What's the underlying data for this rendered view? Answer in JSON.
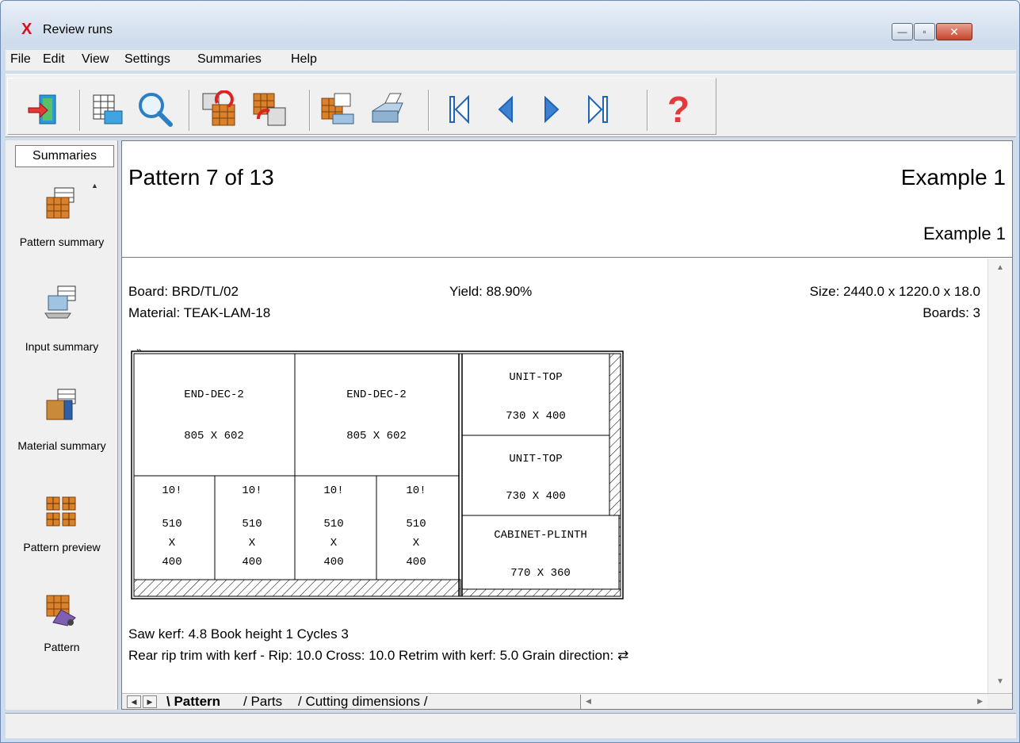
{
  "window": {
    "title": "Review runs",
    "logo": "X",
    "controls": {
      "minimize": "—",
      "maximize": "▫",
      "close": "✕"
    }
  },
  "menu": [
    "File",
    "Edit",
    "View",
    "Settings",
    "Summaries",
    "Help"
  ],
  "toolbar": {
    "icons": [
      "exit-icon",
      "input-table-icon",
      "search-icon",
      "undo-pattern-icon",
      "redo-pattern-icon",
      "print-preview-icon",
      "print-icon",
      "first-icon",
      "previous-icon",
      "next-icon",
      "last-icon",
      "help-icon"
    ],
    "help_glyph": "?"
  },
  "sidebar": {
    "header": "Summaries",
    "items": [
      {
        "label": "Pattern summary",
        "icon": "pattern-summary-icon"
      },
      {
        "label": "Input summary",
        "icon": "input-summary-icon"
      },
      {
        "label": "Material summary",
        "icon": "material-summary-icon"
      },
      {
        "label": "Pattern preview",
        "icon": "pattern-preview-icon"
      },
      {
        "label": "Pattern",
        "icon": "pattern-icon"
      }
    ]
  },
  "document": {
    "pattern_title": "Pattern 7 of 13",
    "example_title": "Example 1",
    "example_subtitle": "Example 1",
    "board": "Board: BRD/TL/02",
    "material": "Material: TEAK-LAM-18",
    "yield": "Yield: 88.90%",
    "size": "Size: 2440.0 x 1220.0 x  18.0",
    "boards": "Boards: 3",
    "kerf_line": "Saw kerf: 4.8  Book height 1  Cycles 3",
    "trim_line": "Rear rip trim with kerf - Rip: 10.0 Cross: 10.0 Retrim with kerf: 5.0 Grain direction:",
    "grain_glyph": "⇄"
  },
  "pattern": {
    "parts": [
      {
        "name": "END-DEC-2",
        "dims": "805 X 602"
      },
      {
        "name": "END-DEC-2",
        "dims": "805 X 602"
      },
      {
        "name": "10!",
        "w": "510",
        "x": "X",
        "h": "400"
      },
      {
        "name": "10!",
        "w": "510",
        "x": "X",
        "h": "400"
      },
      {
        "name": "10!",
        "w": "510",
        "x": "X",
        "h": "400"
      },
      {
        "name": "10!",
        "w": "510",
        "x": "X",
        "h": "400"
      },
      {
        "name": "UNIT-TOP",
        "dims": "730 X 400"
      },
      {
        "name": "UNIT-TOP",
        "dims": "730 X 400"
      },
      {
        "name": "CABINET-PLINTH",
        "dims": "770 X 360"
      }
    ]
  },
  "tabs": [
    "Pattern",
    "Parts",
    "Cutting dimensions"
  ],
  "colors": {
    "chrome": "#cfdcec",
    "panel": "#f0f0f0",
    "logo": "#d3121b",
    "close": "#c6452d"
  }
}
